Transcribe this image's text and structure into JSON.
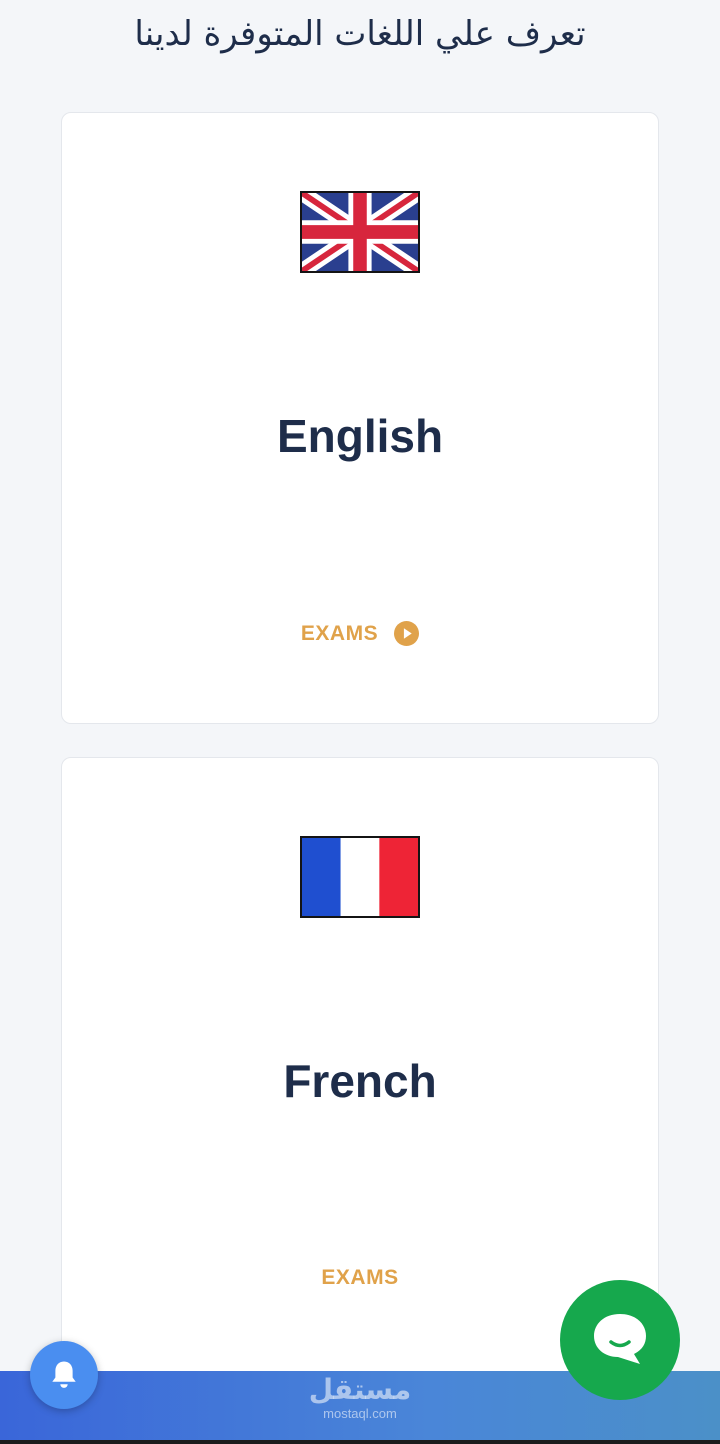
{
  "heading": "تعرف علي اللغات المتوفرة لدينا",
  "languages": [
    {
      "name": "English",
      "flag_icon": "uk-flag-icon",
      "action_label": "EXAMS",
      "action_icon": "play-circle-icon"
    },
    {
      "name": "French",
      "flag_icon": "france-flag-icon",
      "action_label": "EXAMS"
    }
  ],
  "floating": {
    "notification_icon": "bell-icon",
    "chat_icon": "chat-bubble-icon"
  },
  "watermark": {
    "arabic": "مستقل",
    "latin": "mostaql.com"
  },
  "colors": {
    "background": "#f4f6f9",
    "card": "#ffffff",
    "title_text": "#1e2d4a",
    "action_accent": "#e0a24a",
    "chat_button": "#16a84d",
    "notification_button": "#4a8ef0",
    "bottom_bar_start": "#3a66d9",
    "bottom_bar_end": "#4b90c8"
  }
}
